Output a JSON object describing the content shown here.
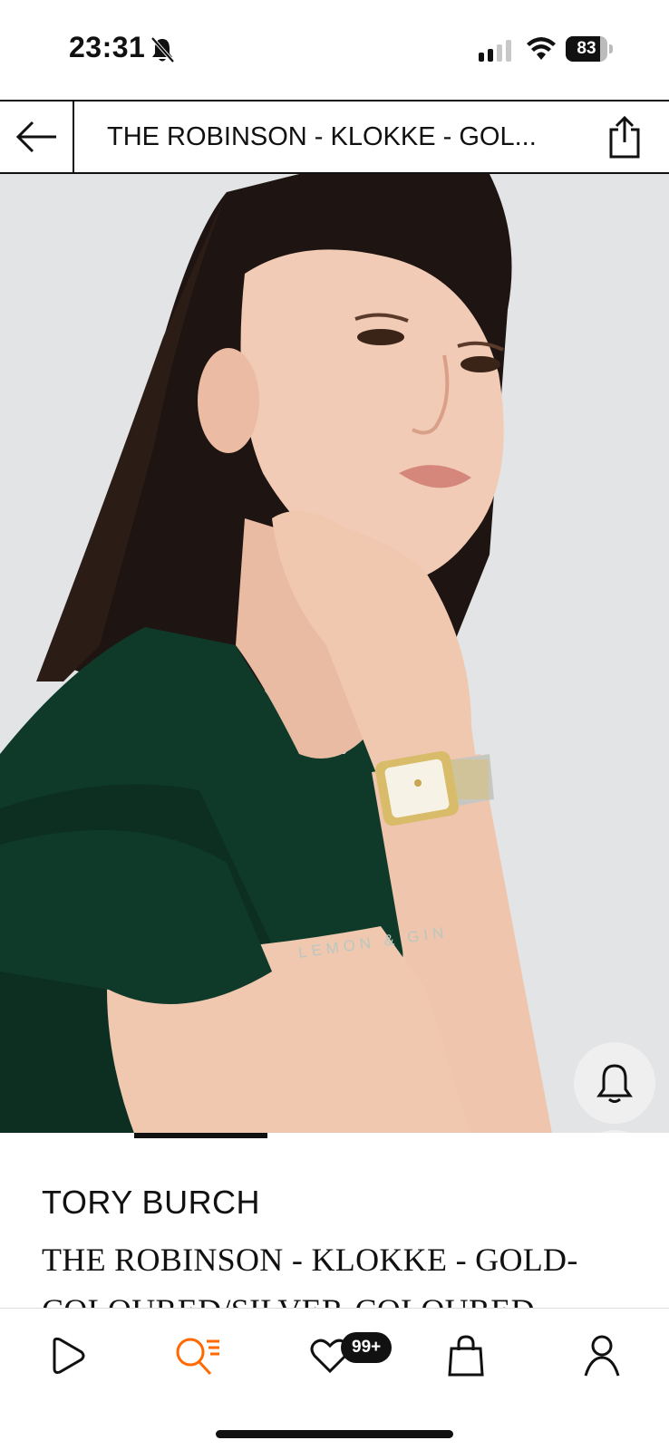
{
  "status_bar": {
    "time": "23:31",
    "battery_level": "83",
    "battery_fraction": 0.83
  },
  "header": {
    "title": "THE ROBINSON - KLOKKE - GOL...",
    "back_icon": "arrow-left-icon",
    "share_icon": "share-icon"
  },
  "gallery": {
    "image_alt": "Model wearing a gold and silver watch",
    "print_on_shirt": "LEMON & GIN",
    "current_index": 1,
    "total_images": 5
  },
  "actions": {
    "notify_icon": "bell-icon",
    "wishlist_icon": "heart-icon",
    "bag_icon": "shopping-bag-icon",
    "ai_icon": "sparkle-chat-icon"
  },
  "product": {
    "brand": "TORY BURCH",
    "name": "THE ROBINSON - KLOKKE - GOLD-COLOURED/SILVER-COLOURED"
  },
  "bottom_nav": {
    "items": [
      {
        "name": "discover",
        "icon": "play-icon",
        "active": false
      },
      {
        "name": "search",
        "icon": "search-list-icon",
        "active": true
      },
      {
        "name": "wishlist",
        "icon": "heart-icon",
        "active": false
      },
      {
        "name": "bag",
        "icon": "shopping-bag-icon",
        "active": false
      },
      {
        "name": "account",
        "icon": "person-icon",
        "active": false
      }
    ],
    "wishlist_badge": "99+"
  },
  "colors": {
    "accent": "#ff6900",
    "dark": "#111111",
    "shirt_green": "#0e3a28"
  }
}
